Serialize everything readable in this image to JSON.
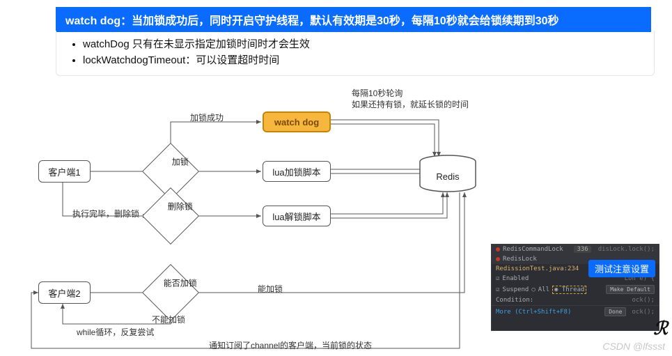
{
  "banner": "watch dog：当加锁成功后，同时开启守护线程，默认有效期是30秒，每隔10秒就会给锁续期到30秒",
  "notes": [
    "watchDog 只有在未显示指定加锁时间时才会生效",
    "lockWatchdogTimeout：可以设置超时时间"
  ],
  "nodes": {
    "client1": "客户端1",
    "client2": "客户端2",
    "lock": "加锁",
    "unlock": "删除锁",
    "canlock": "能否加锁",
    "watchdog": "watch dog",
    "luaLock": "lua加锁脚本",
    "luaUnlock": "lua解锁脚本",
    "redis": "Redis"
  },
  "edges": {
    "lockSuccess": "加锁成功",
    "execDone": "执行完毕，删除锁",
    "poll1": "每隔10秒轮询",
    "poll2": "如果还持有锁，就延长锁的时间",
    "canLockYes": "能加锁",
    "canLockNo": "不能加锁",
    "retry": "while循环，反复尝试",
    "notify": "通知订阅了channel的客户端，当前锁的状态"
  },
  "ide": {
    "bp1": "RedisCommandLock",
    "bp2": "RedisLock",
    "count": "336",
    "frag": "disLock.lock();",
    "file": "RedissionTest.java:234",
    "enabled": "Enabled",
    "suspend": "Suspend",
    "all": "All",
    "thread": "Thread",
    "makeDefault": "Make Default",
    "condition": "Condition:",
    "loop": "Lon e) {",
    "ock": "ock();",
    "more": "More (Ctrl+Shift+F8)",
    "done": "Done"
  },
  "badge": "测试注意设置",
  "watermark": "CSDN @lfssst"
}
